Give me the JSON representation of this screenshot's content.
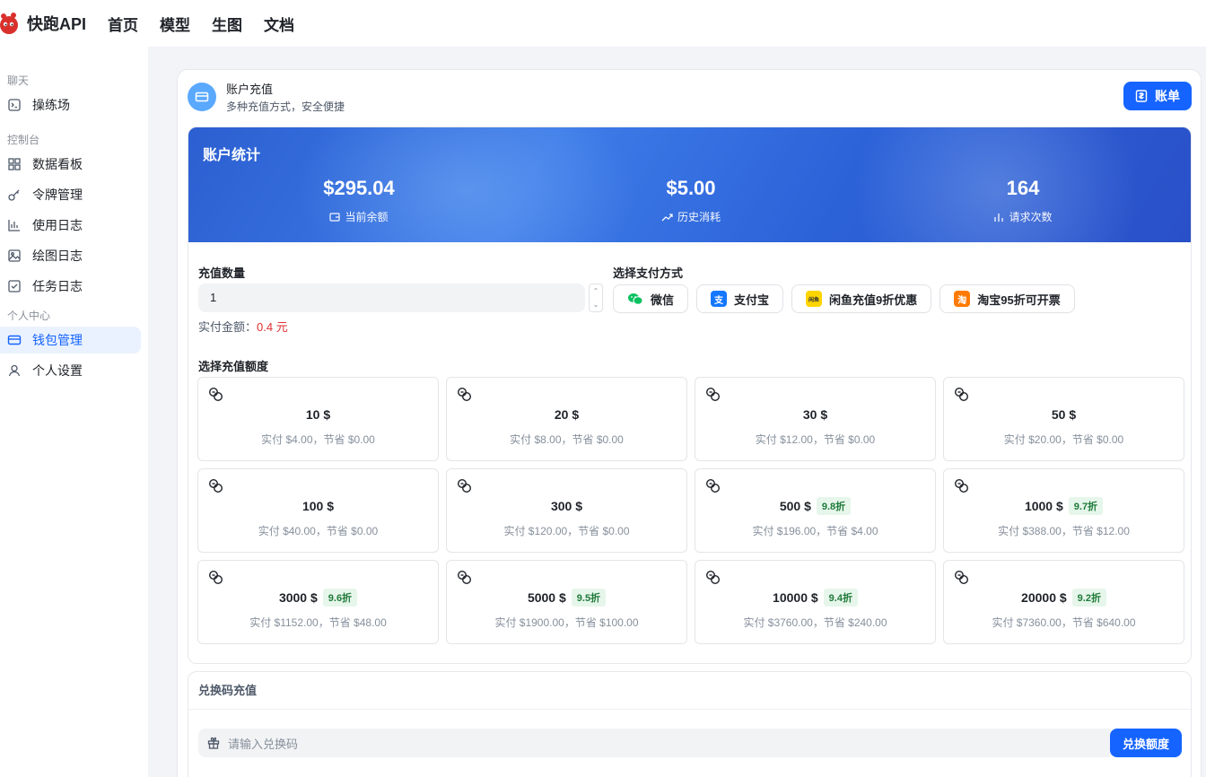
{
  "brand": {
    "name": "快跑API",
    "logo_icon": "red-creature-logo"
  },
  "nav": {
    "items": [
      "首页",
      "模型",
      "生图",
      "文档"
    ]
  },
  "sidebar": {
    "groups": [
      {
        "label": "聊天",
        "items": [
          {
            "label": "操练场",
            "icon": "terminal-icon"
          }
        ]
      },
      {
        "label": "控制台",
        "items": [
          {
            "label": "数据看板",
            "icon": "dashboard-icon"
          },
          {
            "label": "令牌管理",
            "icon": "key-icon"
          },
          {
            "label": "使用日志",
            "icon": "bar-chart-icon"
          },
          {
            "label": "绘图日志",
            "icon": "image-icon"
          },
          {
            "label": "任务日志",
            "icon": "checkbox-icon"
          }
        ]
      },
      {
        "label": "个人中心",
        "items": [
          {
            "label": "钱包管理",
            "icon": "wallet-icon",
            "active": true
          },
          {
            "label": "个人设置",
            "icon": "user-icon"
          }
        ]
      }
    ]
  },
  "header": {
    "title": "账户充值",
    "subtitle": "多种充值方式，安全便捷",
    "bill_button": "账单"
  },
  "stats": {
    "title": "账户统计",
    "balance": {
      "value": "$295.04",
      "label": "当前余额"
    },
    "spent": {
      "value": "$5.00",
      "label": "历史消耗"
    },
    "requests": {
      "value": "164",
      "label": "请求次数"
    }
  },
  "recharge": {
    "quantity_label": "充值数量",
    "quantity_value": "1",
    "paid_label": "实付金额：",
    "paid_amount": "0.4 元",
    "payment_label": "选择支付方式",
    "payments": [
      {
        "label": "微信",
        "icon": "wechat-icon",
        "color": "#07c160"
      },
      {
        "label": "支付宝",
        "icon": "alipay-icon",
        "color": "#1677ff"
      },
      {
        "label": "闲鱼充值9折优惠",
        "icon": "xianyu-icon",
        "color": "#ffd500"
      },
      {
        "label": "淘宝95折可开票",
        "icon": "taobao-icon",
        "color": "#ff7a00"
      }
    ],
    "amount_label": "选择充值额度",
    "options": [
      {
        "amount": "10 $",
        "discount": "",
        "detail": "实付 $4.00，节省 $0.00"
      },
      {
        "amount": "20 $",
        "discount": "",
        "detail": "实付 $8.00，节省 $0.00"
      },
      {
        "amount": "30 $",
        "discount": "",
        "detail": "实付 $12.00，节省 $0.00"
      },
      {
        "amount": "50 $",
        "discount": "",
        "detail": "实付 $20.00，节省 $0.00"
      },
      {
        "amount": "100 $",
        "discount": "",
        "detail": "实付 $40.00，节省 $0.00"
      },
      {
        "amount": "300 $",
        "discount": "",
        "detail": "实付 $120.00，节省 $0.00"
      },
      {
        "amount": "500 $",
        "discount": "9.8折",
        "detail": "实付 $196.00，节省 $4.00"
      },
      {
        "amount": "1000 $",
        "discount": "9.7折",
        "detail": "实付 $388.00，节省 $12.00"
      },
      {
        "amount": "3000 $",
        "discount": "9.6折",
        "detail": "实付 $1152.00，节省 $48.00"
      },
      {
        "amount": "5000 $",
        "discount": "9.5折",
        "detail": "实付 $1900.00，节省 $100.00"
      },
      {
        "amount": "10000 $",
        "discount": "9.4折",
        "detail": "实付 $3760.00，节省 $240.00"
      },
      {
        "amount": "20000 $",
        "discount": "9.2折",
        "detail": "实付 $7360.00，节省 $640.00"
      }
    ]
  },
  "redeem": {
    "title": "兑换码充值",
    "placeholder": "请输入兑换码",
    "button": "兑换额度"
  },
  "colors": {
    "accent": "#1664ff",
    "danger": "#e03030",
    "discount_bg": "#e6f6ea"
  }
}
